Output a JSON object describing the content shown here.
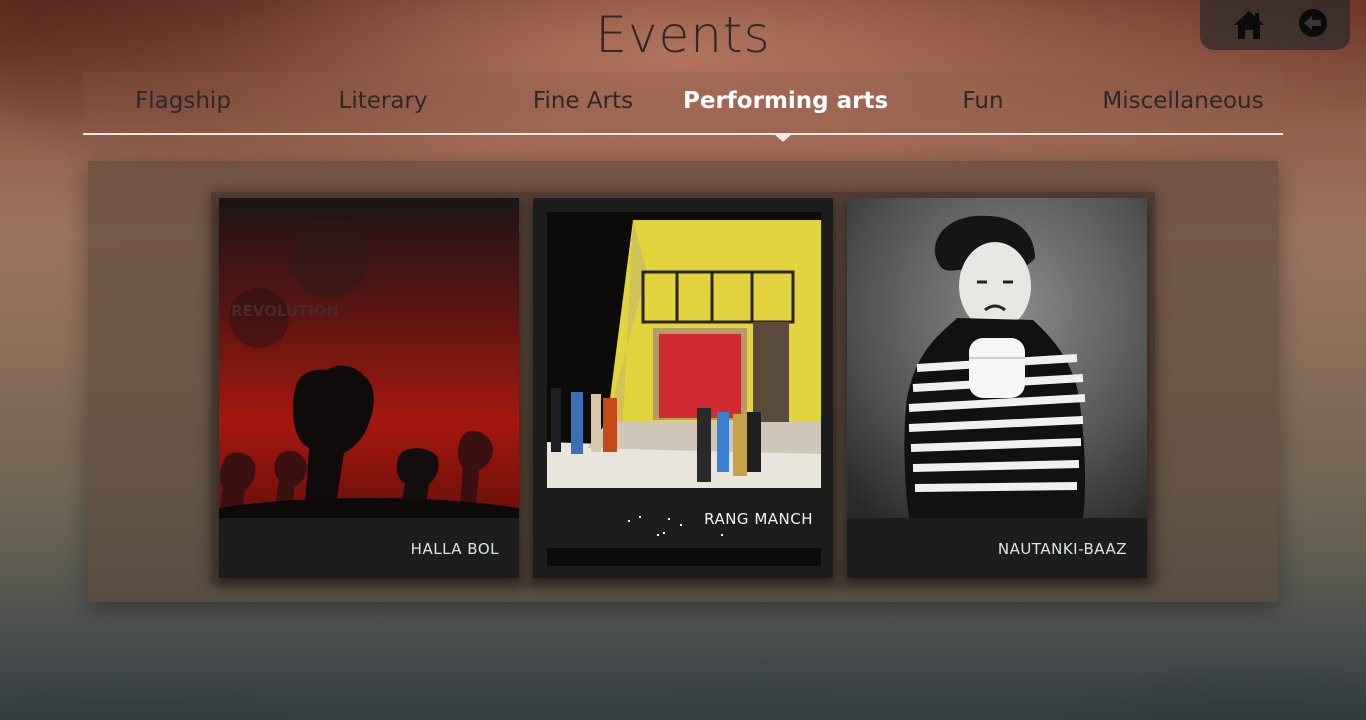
{
  "page": {
    "title": "Events"
  },
  "nav_buttons": {
    "home_icon": "home-icon",
    "back_icon": "arrow-left-circle-icon"
  },
  "tabs": [
    {
      "label": "Flagship",
      "active": false
    },
    {
      "label": "Literary",
      "active": false
    },
    {
      "label": "Fine Arts",
      "active": false
    },
    {
      "label": "Performing arts",
      "active": true
    },
    {
      "label": "Fun",
      "active": false
    },
    {
      "label": "Miscellaneous",
      "active": false
    }
  ],
  "cards": [
    {
      "label": "HALLA BOL",
      "image": "raised-fists-poster",
      "poster_text": "REVOLUTION"
    },
    {
      "label": "RANG MANCH",
      "image": "stage-play-photo"
    },
    {
      "label": "NAUTANKI-BAAZ",
      "image": "mime-artist-photo"
    }
  ],
  "colors": {
    "active_tab": "#ffffff",
    "inactive_tab": "#2e2826",
    "card_bg": "#1e1d1d",
    "card_label": "#d9e6e6"
  }
}
